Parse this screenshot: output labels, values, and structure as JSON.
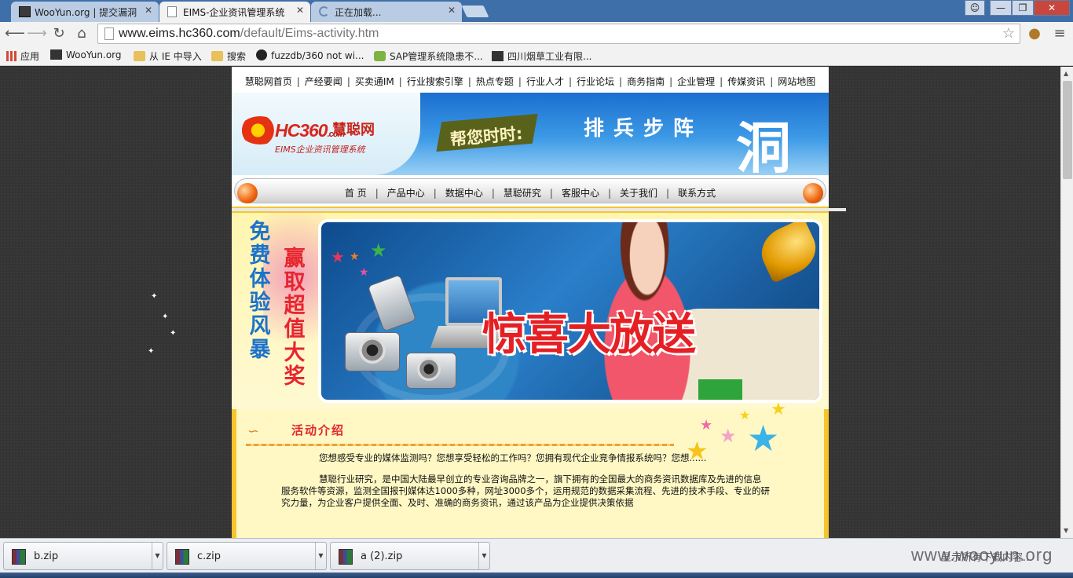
{
  "browser": {
    "tabs": [
      {
        "title": "WooYun.org | 提交漏洞"
      },
      {
        "title": "EIMS-企业资讯管理系统"
      },
      {
        "title": "正在加载..."
      }
    ],
    "window_controls": {
      "minimize": "—",
      "maximize": "❐",
      "close": "✕",
      "user": "☺"
    },
    "nav_icons": {
      "back": "back-arrow-icon",
      "forward": "forward-arrow-icon",
      "reload": "reload-icon",
      "home": "home-icon"
    },
    "url": {
      "host": "www.eims.hc360.com",
      "path": "/default/Eims-activity.htm"
    },
    "bookmarks": [
      {
        "label": "应用",
        "icon": "apps-grid-icon",
        "color": "#d04a3a"
      },
      {
        "label": "WooYun.org",
        "icon": "wooyun-icon",
        "color": "#333333"
      },
      {
        "label": "从 IE 中导入",
        "icon": "folder-icon",
        "color": "#e8c15a"
      },
      {
        "label": "搜索",
        "icon": "folder-icon",
        "color": "#e8c15a"
      },
      {
        "label": "fuzzdb/360 not wi...",
        "icon": "github-icon",
        "color": "#222222"
      },
      {
        "label": "SAP管理系统隐患不...",
        "icon": "check-icon",
        "color": "#7cb342"
      },
      {
        "label": "四川烟草工业有限...",
        "icon": "wooyun-icon",
        "color": "#333333"
      }
    ]
  },
  "site": {
    "top_nav": [
      "慧聪网首页",
      "产经要闻",
      "买卖通IM",
      "行业搜索引擎",
      "热点专题",
      "行业人才",
      "行业论坛",
      "商务指南",
      "企业管理",
      "传媒资讯",
      "网站地图"
    ],
    "banner": {
      "logo": "HC360",
      "logo_suffix": ".com",
      "logo_cn": "慧聪网",
      "logo_sub": "EIMS企业资讯管理系统",
      "slogan": "帮您时时:",
      "words": "排兵步阵",
      "big_char": "洞"
    },
    "main_nav": [
      "首 页",
      "产品中心",
      "数据中心",
      "慧聪研究",
      "客服中心",
      "关于我们",
      "联系方式"
    ],
    "promo": {
      "vertical_left": [
        "免",
        "费",
        "体",
        "验",
        "风",
        "暴"
      ],
      "vertical_right": [
        "赢",
        "取",
        "超",
        "值",
        "大",
        "奖"
      ],
      "headline": "惊喜大放送"
    },
    "intro": {
      "title": "活动介绍",
      "line1": "您想感受专业的媒体监测吗？您想享受轻松的工作吗？您拥有现代企业竞争情报系统吗？您想......",
      "line2": "慧聪行业研究，是中国大陆最早创立的专业咨询品牌之一，旗下拥有的全国最大的商务资讯数据库及先进的信息",
      "line3": "服务软件等资源，监测全国报刊媒体达1000多种，网址3000多个，运用规范的数据采集流程、先进的技术手段、专业的研",
      "line4": "究力量，为企业客户提供全面、及时、准确的商务资讯，通过该产品为企业提供决策依据"
    }
  },
  "downloads": [
    {
      "name": "b.zip"
    },
    {
      "name": "c.zip"
    },
    {
      "name": "a (2).zip"
    }
  ],
  "shelf": {
    "show_all": "显示所有下载内容..."
  },
  "watermark": "www.wooyun.org"
}
